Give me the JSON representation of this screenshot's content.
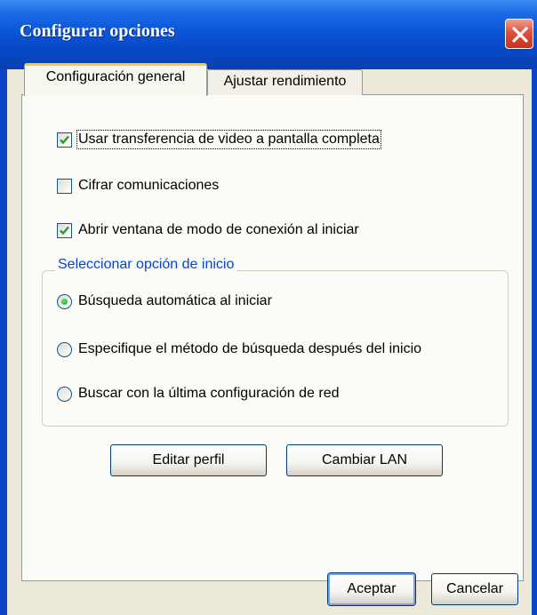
{
  "window": {
    "title": "Configurar opciones",
    "close_icon": "close-icon"
  },
  "tabs": [
    {
      "label": "Configuración general",
      "active": true
    },
    {
      "label": "Ajustar rendimiento",
      "active": false
    }
  ],
  "options": {
    "fullscreen_video": {
      "label": "Usar transferencia de video a pantalla completa",
      "checked": true
    },
    "encrypt": {
      "label": "Cifrar comunicaciones",
      "checked": false
    },
    "connection_mode": {
      "label": "Abrir ventana de modo de conexión al iniciar",
      "checked": true
    }
  },
  "startup_group": {
    "legend": "Seleccionar opción de inicio",
    "options": [
      {
        "label": "Búsqueda automática al iniciar",
        "selected": true
      },
      {
        "label": "Especifique el método de búsqueda después del inicio",
        "selected": false
      },
      {
        "label": "Buscar con la última configuración de red",
        "selected": false
      }
    ]
  },
  "buttons": {
    "edit_profile": "Editar perfil",
    "change_lan": "Cambiar LAN",
    "accept": "Aceptar",
    "cancel": "Cancelar"
  },
  "colors": {
    "titlebar": "#0A55D8",
    "accent": "#0046D5",
    "check": "#21A121",
    "close": "#E0503A"
  }
}
